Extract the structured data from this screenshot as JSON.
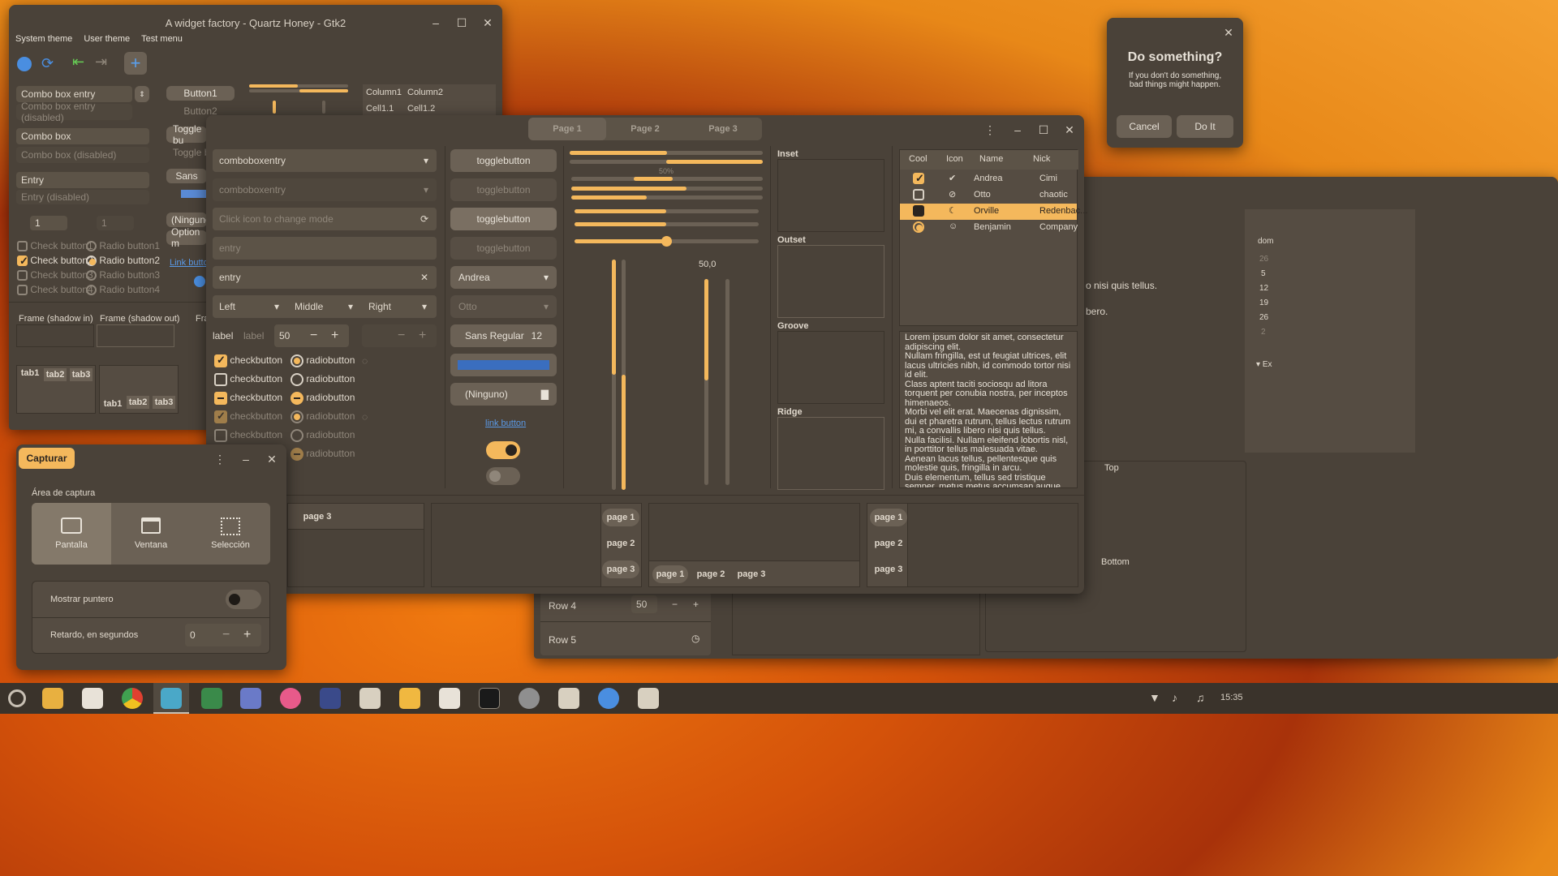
{
  "factory": {
    "title": "A widget factory - Quartz Honey - Gtk2",
    "menu": [
      "System theme",
      "User theme",
      "Test menu"
    ],
    "combo_entry": "Combo box entry",
    "combo_entry_dis": "Combo box entry (disabled)",
    "combo": "Combo box",
    "combo_dis": "Combo box (disabled)",
    "entry": "Entry",
    "entry_dis": "Entry (disabled)",
    "spin1": "1",
    "spin2": "1",
    "checks": [
      "Check button1",
      "Check button2",
      "Check button3",
      "Check button4"
    ],
    "radios": [
      "Radio button1",
      "Radio button2",
      "Radio button3",
      "Radio button4"
    ],
    "button1": "Button1",
    "button2": "Button2",
    "toggle": "Toggle bu",
    "toggle2": "Toggle bu",
    "sans": "Sans",
    "ninguno": "(Ninguno",
    "option": "Option m",
    "link": "Link butto",
    "col1": "Column1",
    "col2": "Column2",
    "cell11": "Cell1.1",
    "cell12": "Cell1.2",
    "frame_in": "Frame (shadow in)",
    "frame_out": "Frame (shadow out)",
    "frame_cut": "Fra",
    "tabs_a": [
      "tab1",
      "tab2",
      "tab3"
    ],
    "tabs_b": [
      "tab1",
      "tab2",
      "tab3"
    ]
  },
  "gtk3": {
    "tabs": [
      "Page 1",
      "Page 2",
      "Page 3"
    ],
    "comboentry1": "comboboxentry",
    "comboentry2": "comboboxentry",
    "icon_placeholder": "Click icon to change mode",
    "entry_ph": "entry",
    "entry_val": "entry",
    "align": [
      "Left",
      "Middle",
      "Right"
    ],
    "label1": "label",
    "label2": "label",
    "spin": "50",
    "checks": [
      "checkbutton",
      "checkbutton",
      "checkbutton",
      "checkbutton",
      "checkbutton"
    ],
    "radios": [
      "radiobutton",
      "radiobutton",
      "radiobutton",
      "radiobutton",
      "radiobutton",
      "radiobutton"
    ],
    "toggles": [
      "togglebutton",
      "togglebutton",
      "togglebutton",
      "togglebutton"
    ],
    "combo_andrea": "Andrea",
    "combo_otto": "Otto",
    "font_name": "Sans Regular",
    "font_size": "12",
    "file_ninguno": "(Ninguno)",
    "link": "link button",
    "progress_label": "50%",
    "scale_value": "50,0",
    "frames": [
      "Inset",
      "Outset",
      "Groove",
      "Ridge"
    ],
    "tree_headers": [
      "Cool",
      "Icon",
      "Name",
      "Nick"
    ],
    "tree_rows": [
      {
        "name": "Andrea",
        "nick": "Cimi"
      },
      {
        "name": "Otto",
        "nick": "chaotic"
      },
      {
        "name": "Orville",
        "nick": "Redenbac..."
      },
      {
        "name": "Benjamin",
        "nick": "Company"
      }
    ],
    "lorem": "Lorem ipsum dolor sit amet, consectetur adipiscing elit.\nNullam fringilla, est ut feugiat ultrices, elit lacus ultricies nibh, id commodo tortor nisi id elit.\nClass aptent taciti sociosqu ad litora torquent per conubia nostra, per inceptos himenaeos.\nMorbi vel elit erat. Maecenas dignissim, dui et pharetra rutrum, tellus lectus rutrum mi, a convallis libero nisi quis tellus.\nNulla facilisi. Nullam eleifend lobortis nisl, in porttitor tellus malesuada vitae.\nAenean lacus tellus, pellentesque quis molestie quis, fringilla in arcu.\nDuis elementum, tellus sed tristique semper, metus metus accumsan augue, et porttitor augue orci a libero.",
    "nb1_tab": "page 3",
    "nb2_tabs": [
      "page 1",
      "page 2",
      "page 3"
    ],
    "nb3_tabs": [
      "page 1",
      "page 2",
      "page 3"
    ],
    "nb4_tabs": [
      "page 1",
      "page 2",
      "page 3"
    ]
  },
  "dialog": {
    "title": "Do something?",
    "text": "If you don't do something,\nbad things might happen.",
    "cancel": "Cancel",
    "ok": "Do It"
  },
  "capture": {
    "title": "Capturar",
    "area": "Área de captura",
    "modes": [
      "Pantalla",
      "Ventana",
      "Selección"
    ],
    "pointer": "Mostrar puntero",
    "delay": "Retardo, en segundos",
    "delay_val": "0"
  },
  "bgwin": {
    "row4": "Row 4",
    "row4_val": "50",
    "row5": "Row 5",
    "text1": "o nisi quis tellus.",
    "text2": "bero.",
    "top": "Top",
    "bottom": "Bottom",
    "cal": [
      "dom",
      "26",
      "5",
      "12",
      "19",
      "26",
      "2"
    ],
    "ex": "Ex"
  },
  "taskbar": {
    "time": "15:35"
  },
  "colors": {
    "accent": "#f4b85c",
    "bg": "#4a4239",
    "widget": "#6b6155"
  }
}
